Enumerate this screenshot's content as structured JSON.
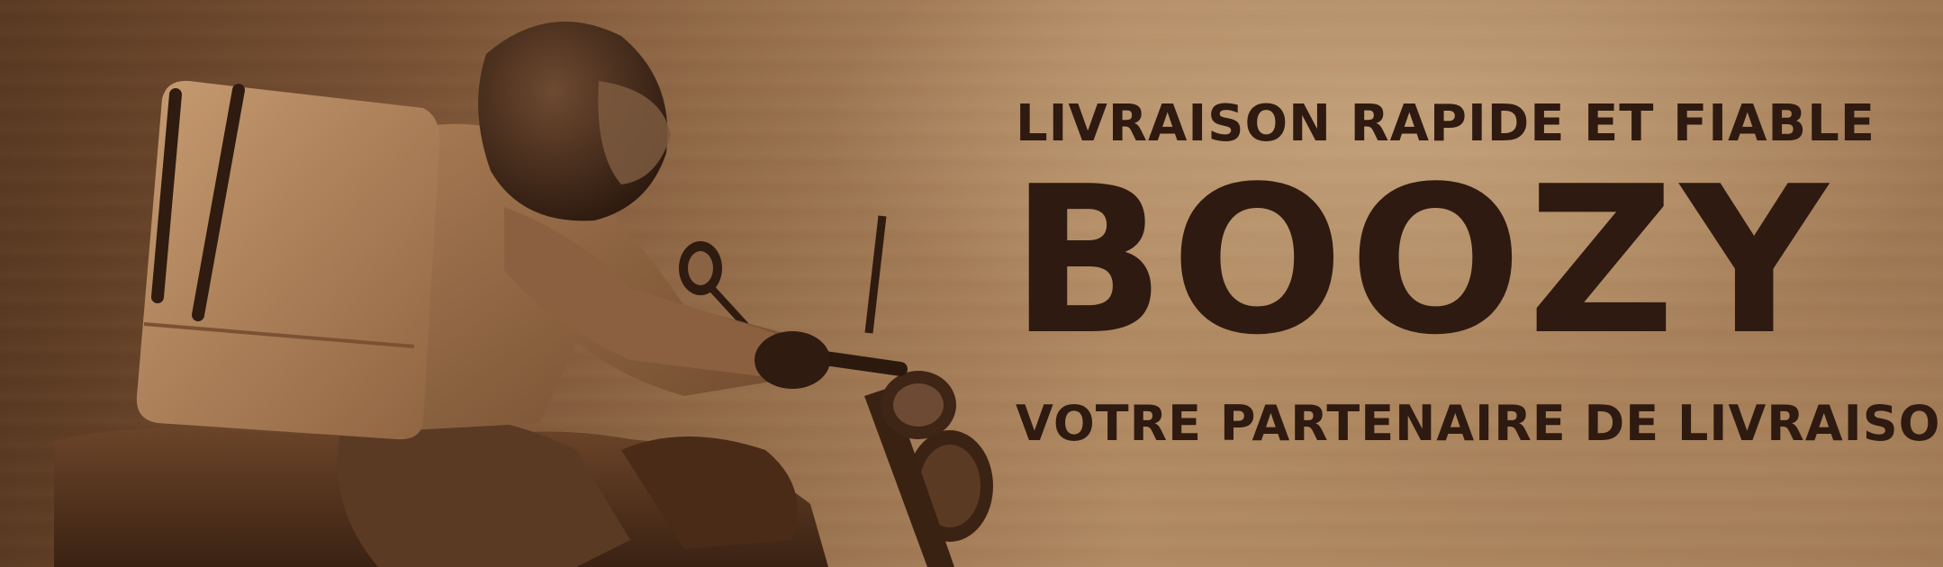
{
  "banner": {
    "tagline": "LIVRAISON RAPIDE ET FIABLE",
    "brand_name": "BOOZY",
    "subtitle": "VOTRE PARTENAIRE DE LIVRAISON"
  },
  "illustration": {
    "subject": "delivery-rider-on-motorcycle",
    "icon": "motorcycle-rider-icon"
  },
  "colors": {
    "text": "#2e1a10",
    "background_light": "#c2a07a",
    "background_dark": "#5a3a22",
    "accent": "#8a5e3b"
  }
}
